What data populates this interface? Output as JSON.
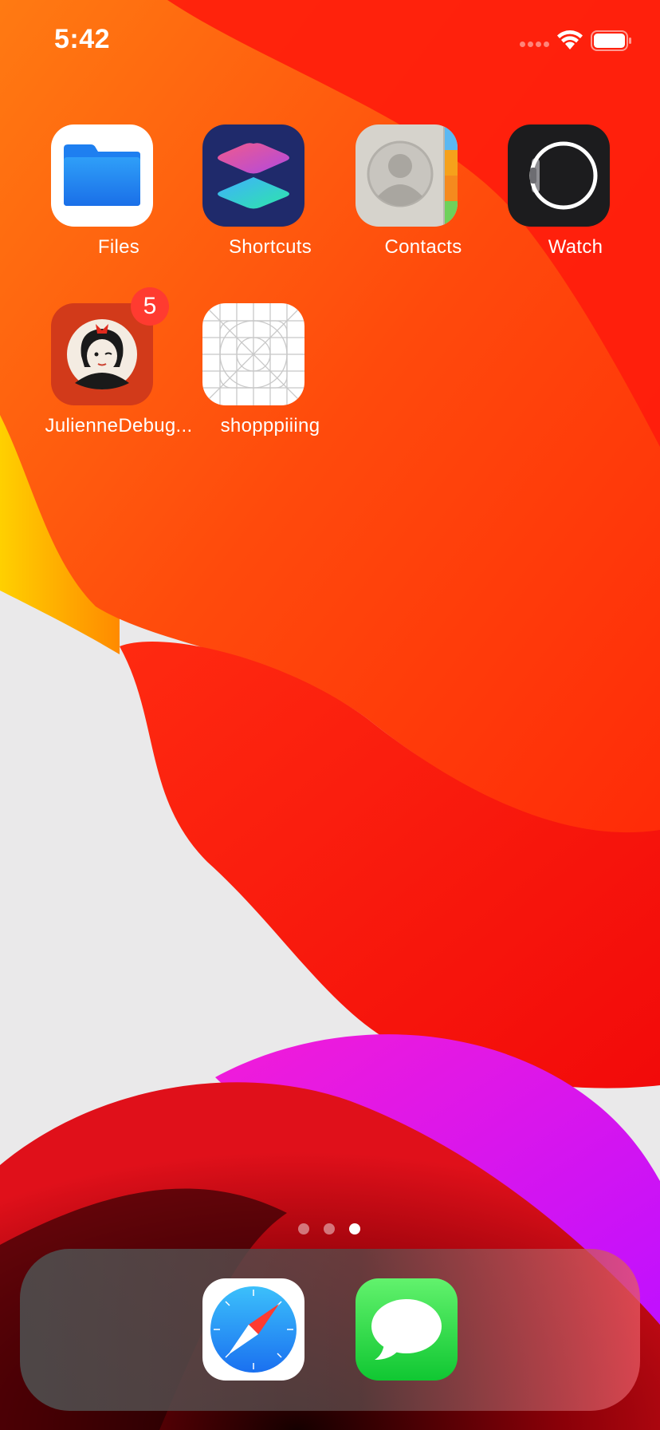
{
  "status_bar": {
    "time": "5:42"
  },
  "home_screen": {
    "apps": [
      {
        "label": "Files",
        "icon": "files-icon"
      },
      {
        "label": "Shortcuts",
        "icon": "shortcuts-icon"
      },
      {
        "label": "Contacts",
        "icon": "contacts-icon"
      },
      {
        "label": "Watch",
        "icon": "watch-icon"
      },
      {
        "label": "JulienneDebug...",
        "icon": "julienne-avatar-icon",
        "badge": "5"
      },
      {
        "label": "shopppiiing",
        "icon": "placeholder-grid-icon"
      }
    ],
    "page_count": 3,
    "current_page": 3
  },
  "dock": {
    "apps": [
      {
        "name": "Safari",
        "icon": "safari-compass-icon"
      },
      {
        "name": "Messages",
        "icon": "messages-bubble-icon"
      }
    ]
  },
  "colors": {
    "badge": "#ff3b30",
    "wallpaper_red": "#ff1a0a",
    "wallpaper_orange": "#ff5a10",
    "wallpaper_yellow": "#ffd400",
    "wallpaper_magenta": "#e81cff"
  }
}
